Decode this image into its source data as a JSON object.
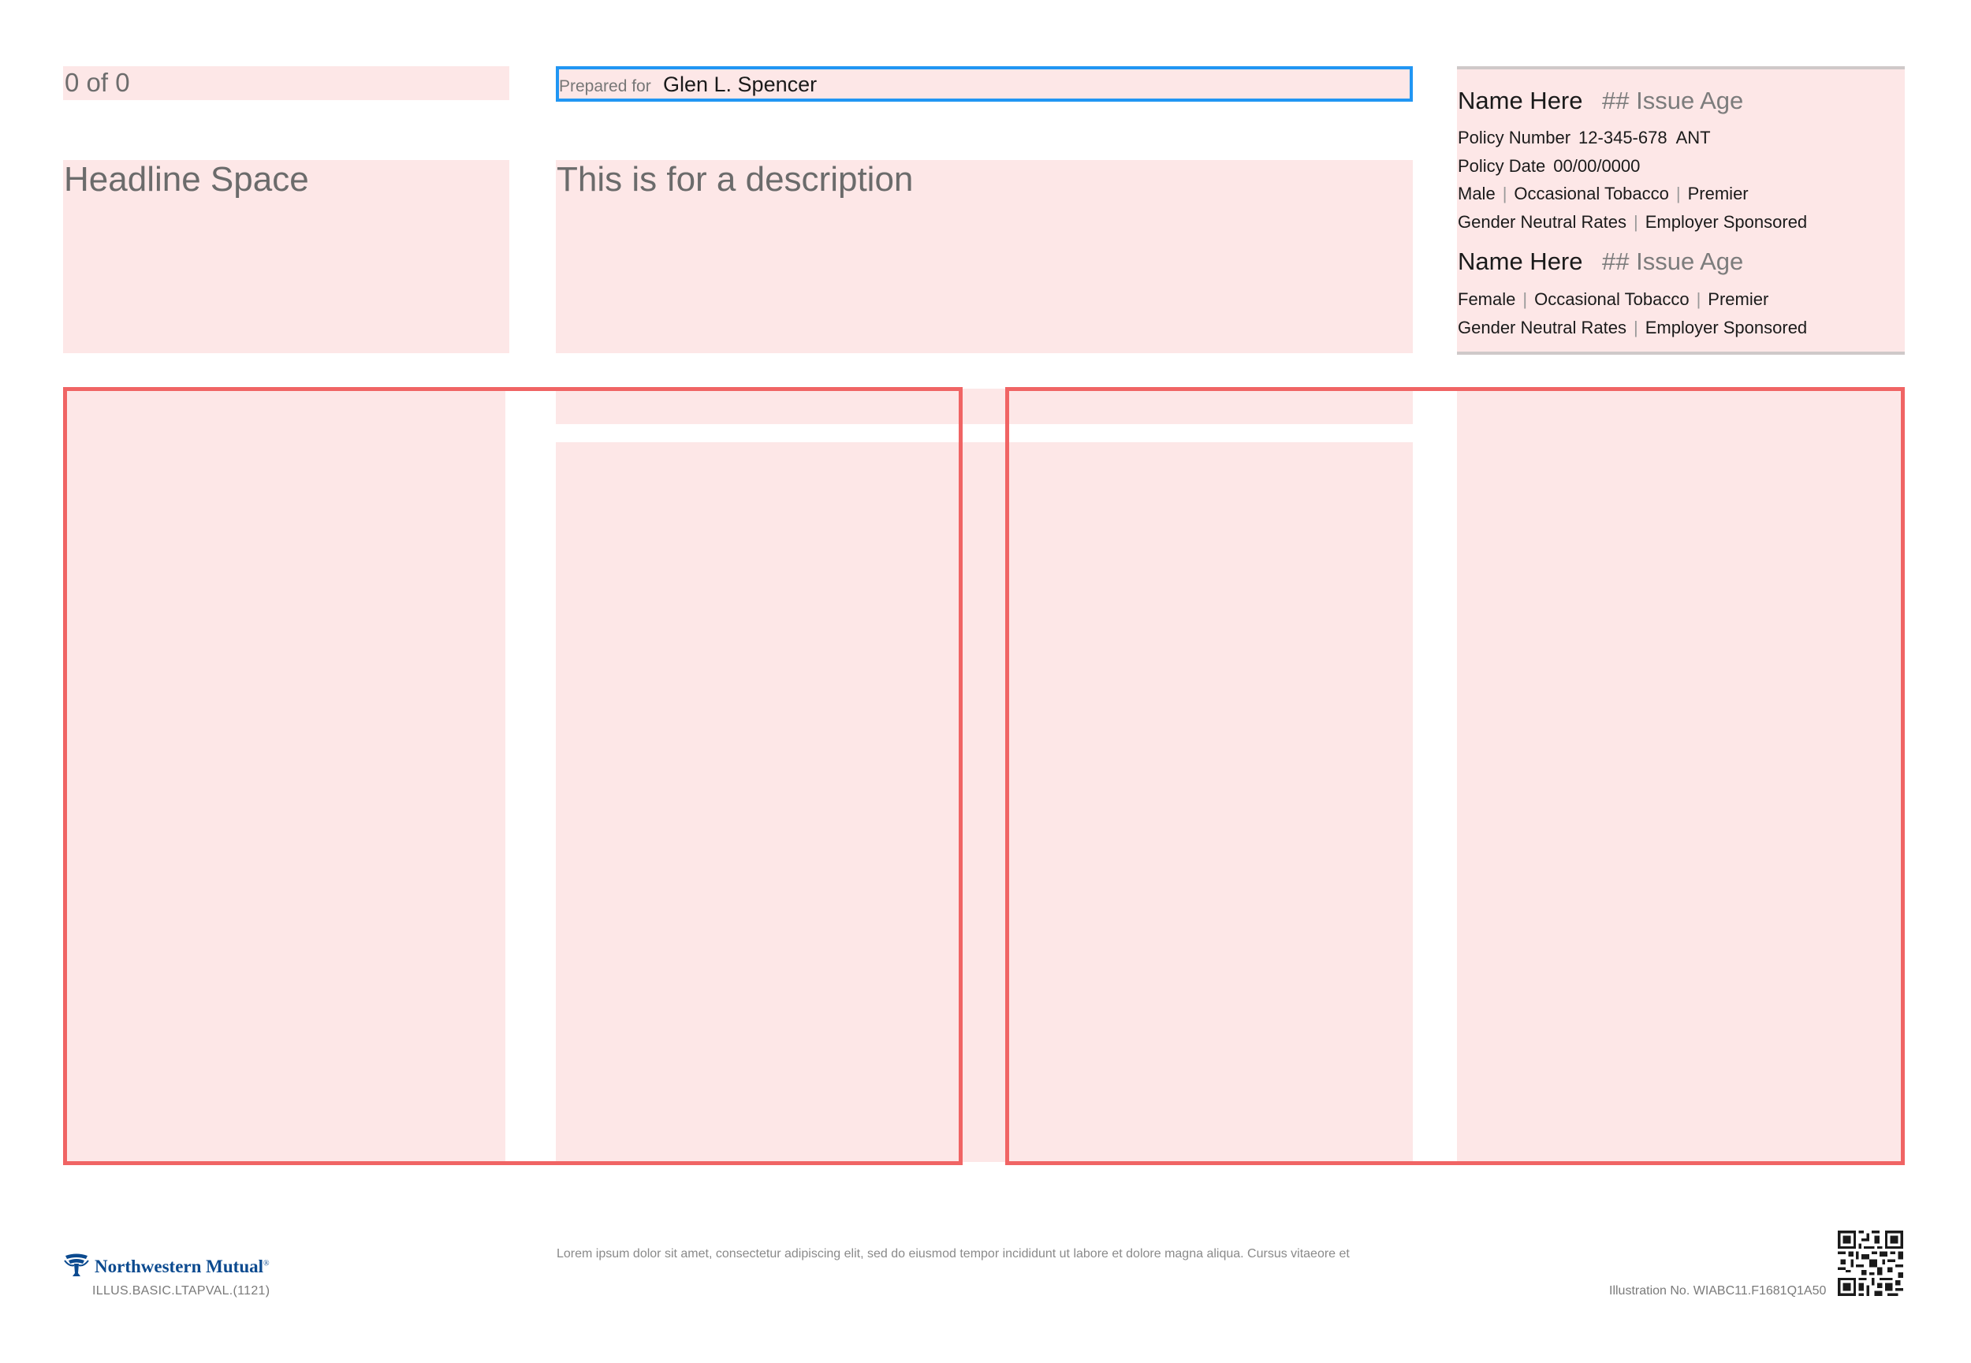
{
  "header": {
    "page_count": "0 of 0",
    "prepared_for_label": "Prepared for",
    "prepared_for_name": "Glen L. Spencer",
    "headline": "Headline Space",
    "description": "This is for a description"
  },
  "insured": [
    {
      "name": "Name Here",
      "issue_age": "## Issue Age",
      "policy_number_label": "Policy Number",
      "policy_number": "12-345-678  ANT",
      "policy_date_label": "Policy Date",
      "policy_date": "00/00/0000",
      "sex": "Male",
      "tobacco": "Occasional Tobacco",
      "class": "Premier",
      "rates": "Gender Neutral Rates",
      "sponsorship": "Employer Sponsored"
    },
    {
      "name": "Name Here",
      "issue_age": "## Issue Age",
      "sex": "Female",
      "tobacco": "Occasional Tobacco",
      "class": "Premier",
      "rates": "Gender Neutral Rates",
      "sponsorship": "Employer Sponsored"
    }
  ],
  "separator": "|",
  "footer": {
    "brand": "Northwestern Mutual",
    "brand_mark": "®",
    "form_code": "ILLUS.BASIC.LTAPVAL.(1121)",
    "disclaimer": "Lorem ipsum dolor sit amet, consectetur adipiscing elit, sed do eiusmod tempor incididunt ut labore et dolore magna aliqua. Cursus vitaeore et",
    "illustration_number": "Illustration No. WIABC11.F1681Q1A50",
    "qr_icon": "qr-code-icon",
    "logo_icon": "northwestern-mutual-logo-icon"
  },
  "colors": {
    "placeholder_fill": "#fde7e7",
    "selection_blue": "#2196f3",
    "frame_red": "#f06464",
    "brand_blue": "#0b4a8f"
  }
}
